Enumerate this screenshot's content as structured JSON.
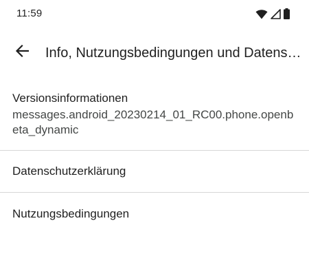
{
  "status_bar": {
    "time": "11:59",
    "icons": [
      "wifi-icon",
      "signal-icon",
      "battery-icon"
    ]
  },
  "app_bar": {
    "back_icon": "arrow-back-icon",
    "title": "Info, Nutzungsbedingungen und Datenschutz"
  },
  "preferences": {
    "version": {
      "title": "Versionsinformationen",
      "summary": "messages.android_20230214_01_RC00.phone.openbeta_dynamic"
    },
    "privacy": {
      "title": "Datenschutzerklärung"
    },
    "terms": {
      "title": "Nutzungsbedingungen"
    }
  },
  "colors": {
    "background": "#ffffff",
    "text_primary": "#1f1f1f",
    "text_secondary": "#444746",
    "divider": "#d7d7d7"
  }
}
